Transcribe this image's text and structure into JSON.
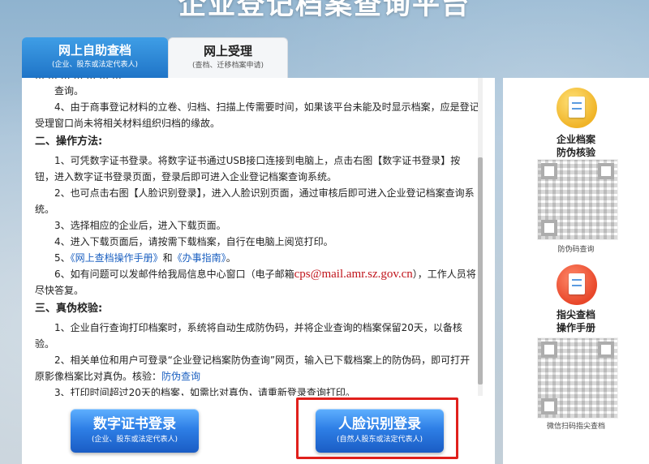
{
  "header": {
    "title": "企业登记档案查询平台"
  },
  "tabs": [
    {
      "label": "网上自助查档",
      "sub": "(企业、股东或法定代表人)"
    },
    {
      "label": "网上受理",
      "sub": "(查档、迁移档案申请)"
    }
  ],
  "content": {
    "clipped_line": "… … … … … … …",
    "line_cont": "查询。",
    "item4": "4、由于商事登记材料的立卷、归档、扫描上传需要时间，如果该平台未能及时显示档案，应是登记受理窗口尚未将相关材料组织归档的缘故。",
    "section2_title": "二、操作方法:",
    "s2_item1": "1、可凭数字证书登录。将数字证书通过USB接口连接到电脑上，点击右图【数字证书登录】按钮，进入数字证书登录页面，登录后即可进入企业登记档案查询系统。",
    "s2_item2": "2、也可点击右图【人脸识别登录】，进入人脸识别页面，通过审核后即可进入企业登记档案查询系统。",
    "s2_item3": "3、选择相应的企业后，进入下载页面。",
    "s2_item4": "4、进入下载页面后，请按需下载档案，自行在电脑上阅览打印。",
    "s2_item5_prefix": "5、",
    "s2_item5_link1": "《网上查档操作手册》",
    "s2_item5_and": "和",
    "s2_item5_link2": "《办事指南》",
    "s2_item5_suffix": "。",
    "s2_item6_a": "6、如有问题可以发邮件给我局信息中心窗口（电子邮箱",
    "s2_item6_email": "cps@mail.amr.sz.gov.cn",
    "s2_item6_b": "），工作人员将尽快答复。",
    "section3_title": "三、真伪校验:",
    "s3_item1": "1、企业自行查询打印档案时，系统将自动生成防伪码，并将企业查询的档案保留20天，以备核验。",
    "s3_item2_a": "2、相关单位和用户可登录“企业登记档案防伪查询”网页，输入已下载档案上的防伪码，即可打开原影像档案比对真伪。核验：",
    "s3_item2_link": "防伪查询",
    "s3_item3": "3、打印时间超过20天的档案，如需比对真伪，请重新登录查询打印。"
  },
  "buttons": {
    "cert_title": "数字证书登录",
    "cert_sub": "(企业、股东或法定代表人)",
    "face_title": "人脸识别登录",
    "face_sub": "(自然人股东或法定代表人)"
  },
  "sidebar": {
    "verify_label_1": "企业档案",
    "verify_label_2": "防伪核验",
    "verify_caption": "防伪码查询",
    "manual_label_1": "指尖查档",
    "manual_label_2": "操作手册",
    "manual_caption": "微信扫码指尖查档"
  },
  "colors": {
    "accent_blue": "#1f74c7",
    "highlight_red": "#e0201c",
    "email_red": "#c0141b",
    "link_blue": "#1a5fc0"
  }
}
